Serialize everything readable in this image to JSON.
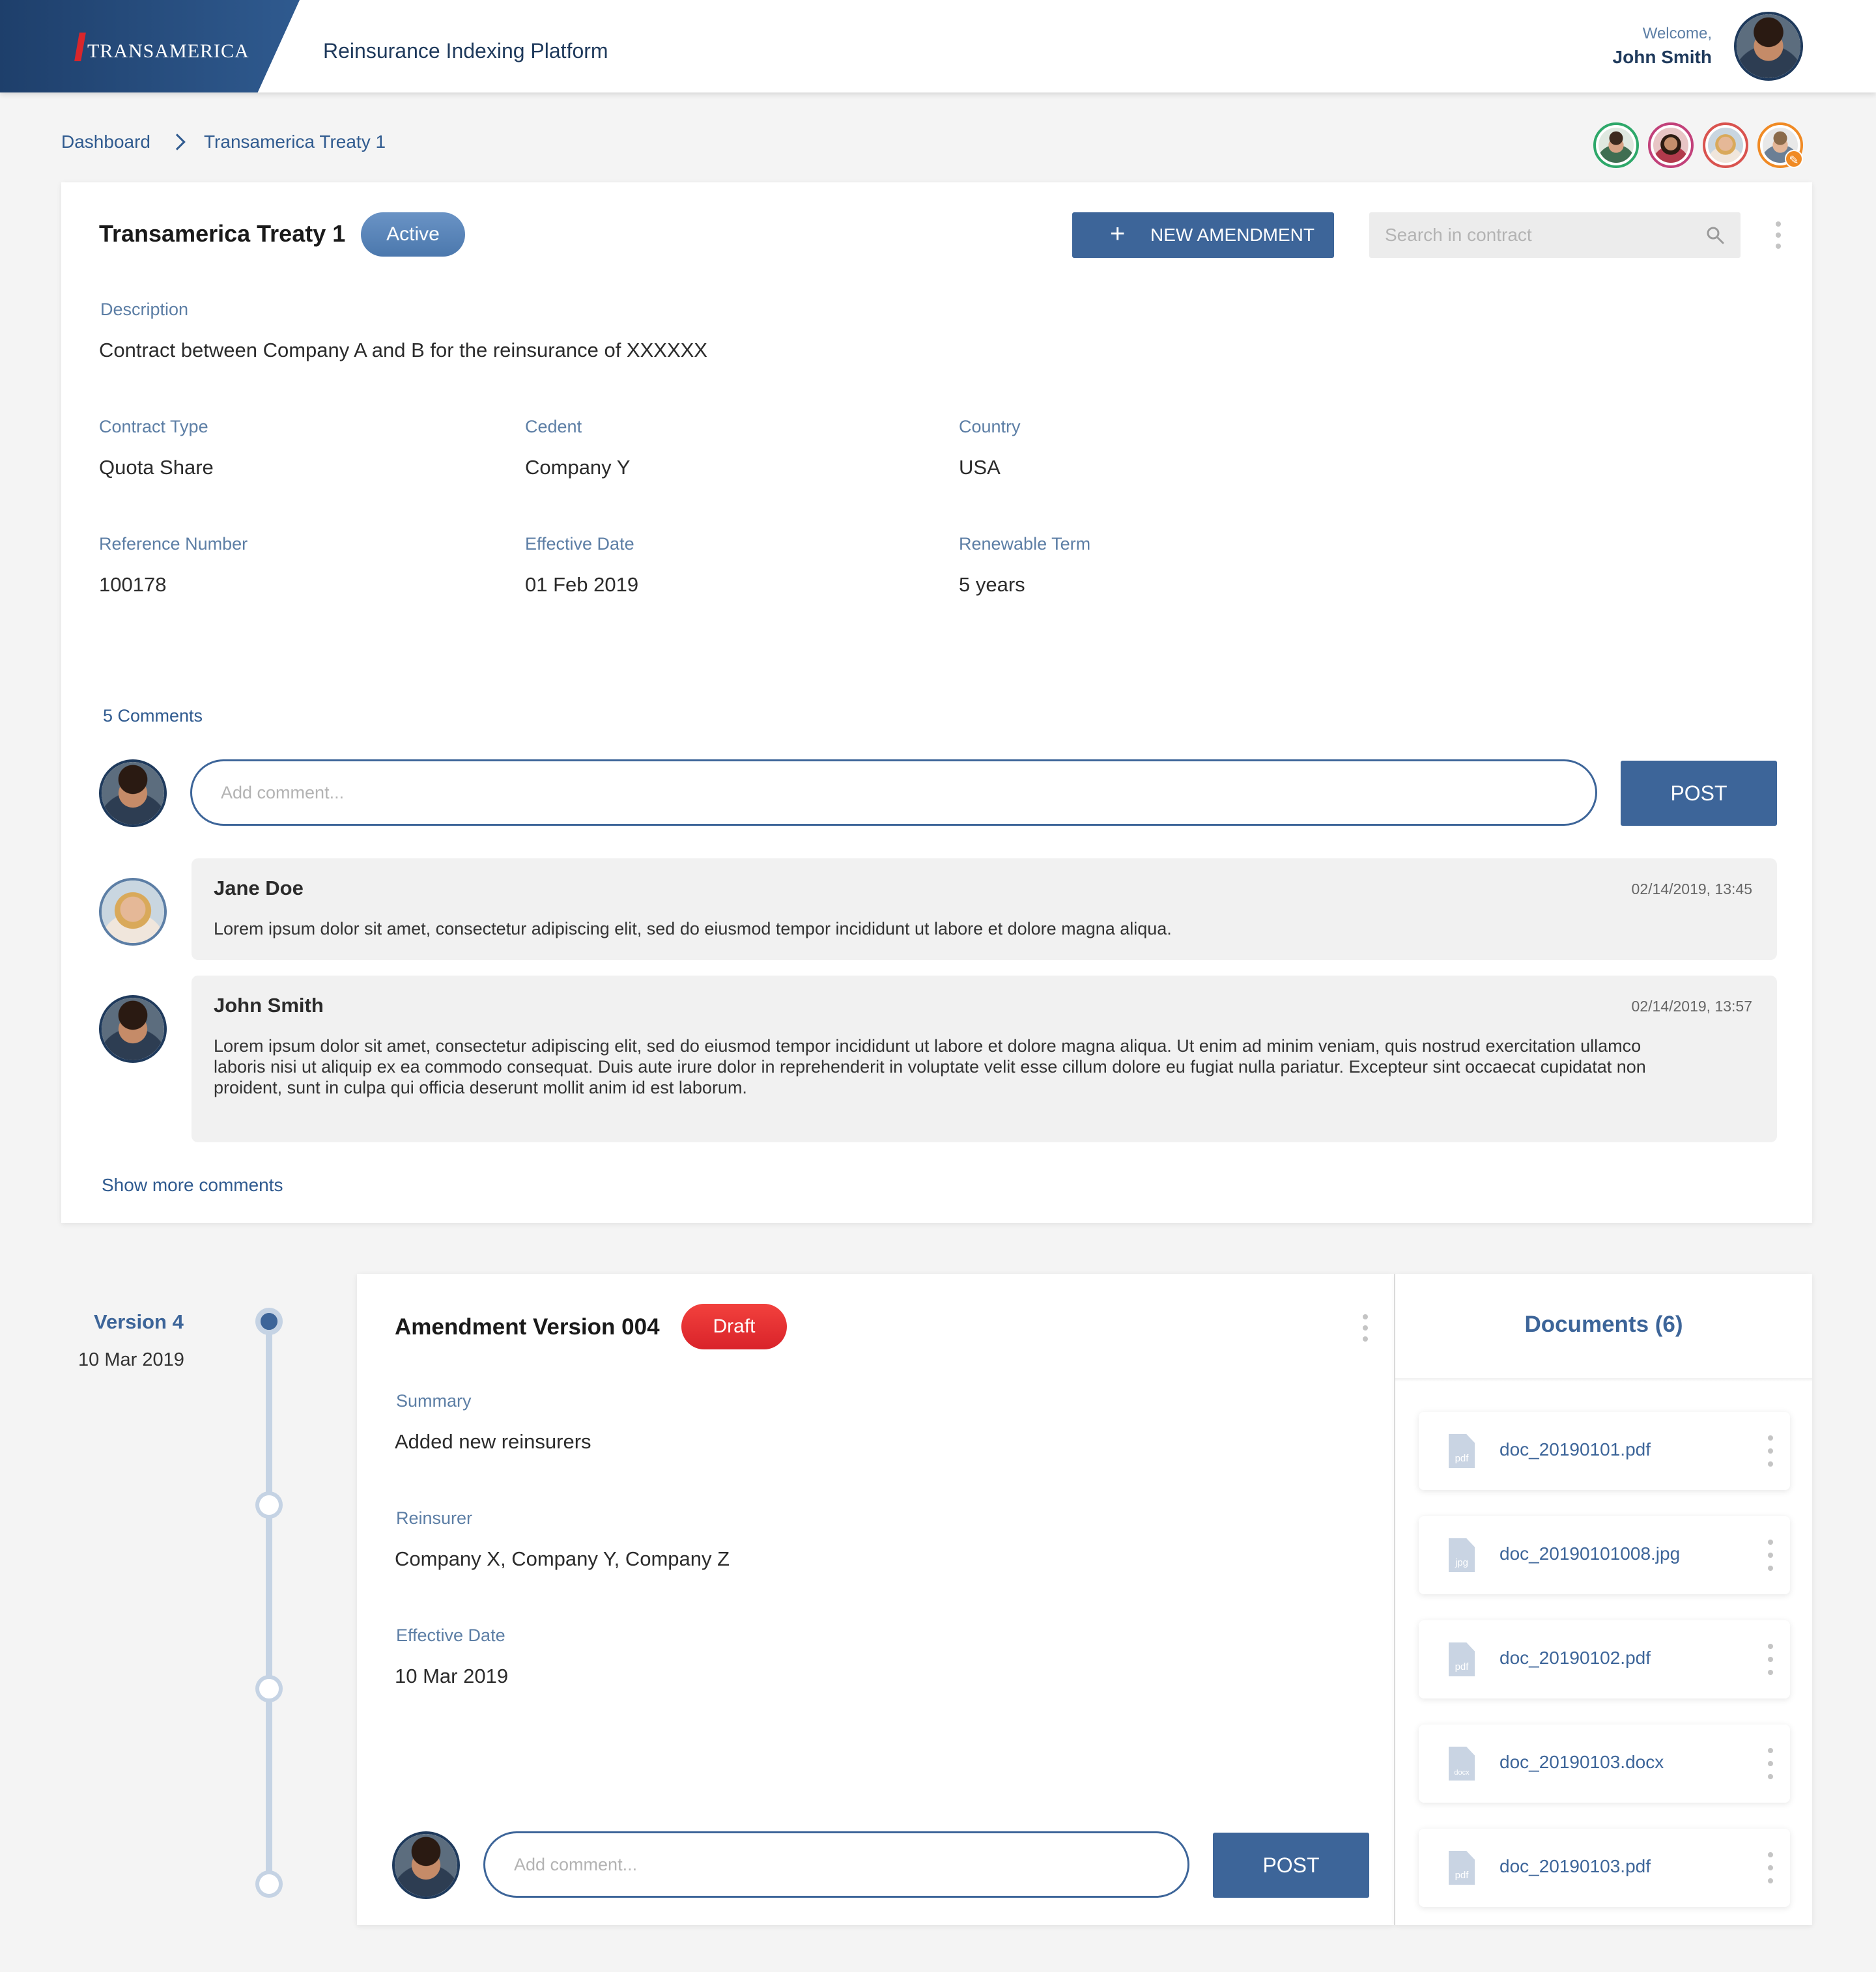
{
  "header": {
    "brand": "TRANSAMERICA",
    "app_title": "Reinsurance Indexing Platform",
    "welcome_label": "Welcome,",
    "user_name": "John Smith"
  },
  "breadcrumb": {
    "items": [
      "Dashboard",
      "Transamerica Treaty 1"
    ]
  },
  "contract": {
    "title": "Transamerica Treaty 1",
    "status": "Active",
    "new_amendment_label": "NEW AMENDMENT",
    "search_placeholder": "Search in contract",
    "description_label": "Description",
    "description": "Contract between Company A and B for the reinsurance of XXXXXX",
    "fields": [
      {
        "label": "Contract Type",
        "value": "Quota Share"
      },
      {
        "label": "Cedent",
        "value": "Company Y"
      },
      {
        "label": "Country",
        "value": "USA"
      },
      {
        "label": "Reference Number",
        "value": "100178"
      },
      {
        "label": "Effective Date",
        "value": "01 Feb 2019"
      },
      {
        "label": "Renewable Term",
        "value": "5 years"
      }
    ]
  },
  "comments": {
    "count_label": "5 Comments",
    "input_placeholder": "Add comment...",
    "post_label": "POST",
    "items": [
      {
        "author": "Jane Doe",
        "time": "02/14/2019, 13:45",
        "text": "Lorem ipsum dolor sit amet, consectetur adipiscing elit, sed do eiusmod tempor incididunt ut labore et dolore magna aliqua."
      },
      {
        "author": "John Smith",
        "time": "02/14/2019, 13:57",
        "text": "Lorem ipsum dolor sit amet, consectetur adipiscing elit, sed do eiusmod tempor incididunt ut labore et dolore magna aliqua. Ut enim ad minim veniam, quis nostrud exercitation ullamco laboris nisi ut aliquip ex ea commodo consequat. Duis aute irure dolor in reprehenderit in voluptate velit esse cillum dolore eu fugiat nulla pariatur. Excepteur sint occaecat cupidatat non proident, sunt in culpa qui officia deserunt mollit anim id est laborum."
      }
    ],
    "show_more_label": "Show more comments"
  },
  "timeline": {
    "version_label": "Version 4",
    "version_date": "10 Mar 2019"
  },
  "amendment": {
    "title": "Amendment Version 004",
    "status": "Draft",
    "summary_label": "Summary",
    "summary": "Added new reinsurers",
    "reinsurer_label": "Reinsurer",
    "reinsurer": "Company X, Company Y, Company Z",
    "effective_date_label": "Effective Date",
    "effective_date": "10 Mar 2019",
    "comment_placeholder": "Add comment...",
    "post_label": "POST"
  },
  "documents": {
    "title": "Documents (6)",
    "items": [
      {
        "name": "doc_20190101.pdf",
        "ext": "pdf"
      },
      {
        "name": "doc_20190101008.jpg",
        "ext": "jpg"
      },
      {
        "name": "doc_20190102.pdf",
        "ext": "pdf"
      },
      {
        "name": "doc_20190103.docx",
        "ext": "docx"
      },
      {
        "name": "doc_20190103.pdf",
        "ext": "pdf"
      }
    ]
  },
  "colors": {
    "primary": "#3d6599",
    "brand_dark": "#1e3f6b",
    "active_badge": "#5a86ba",
    "draft_badge": "#e8302f",
    "label": "#5c7ea5"
  }
}
